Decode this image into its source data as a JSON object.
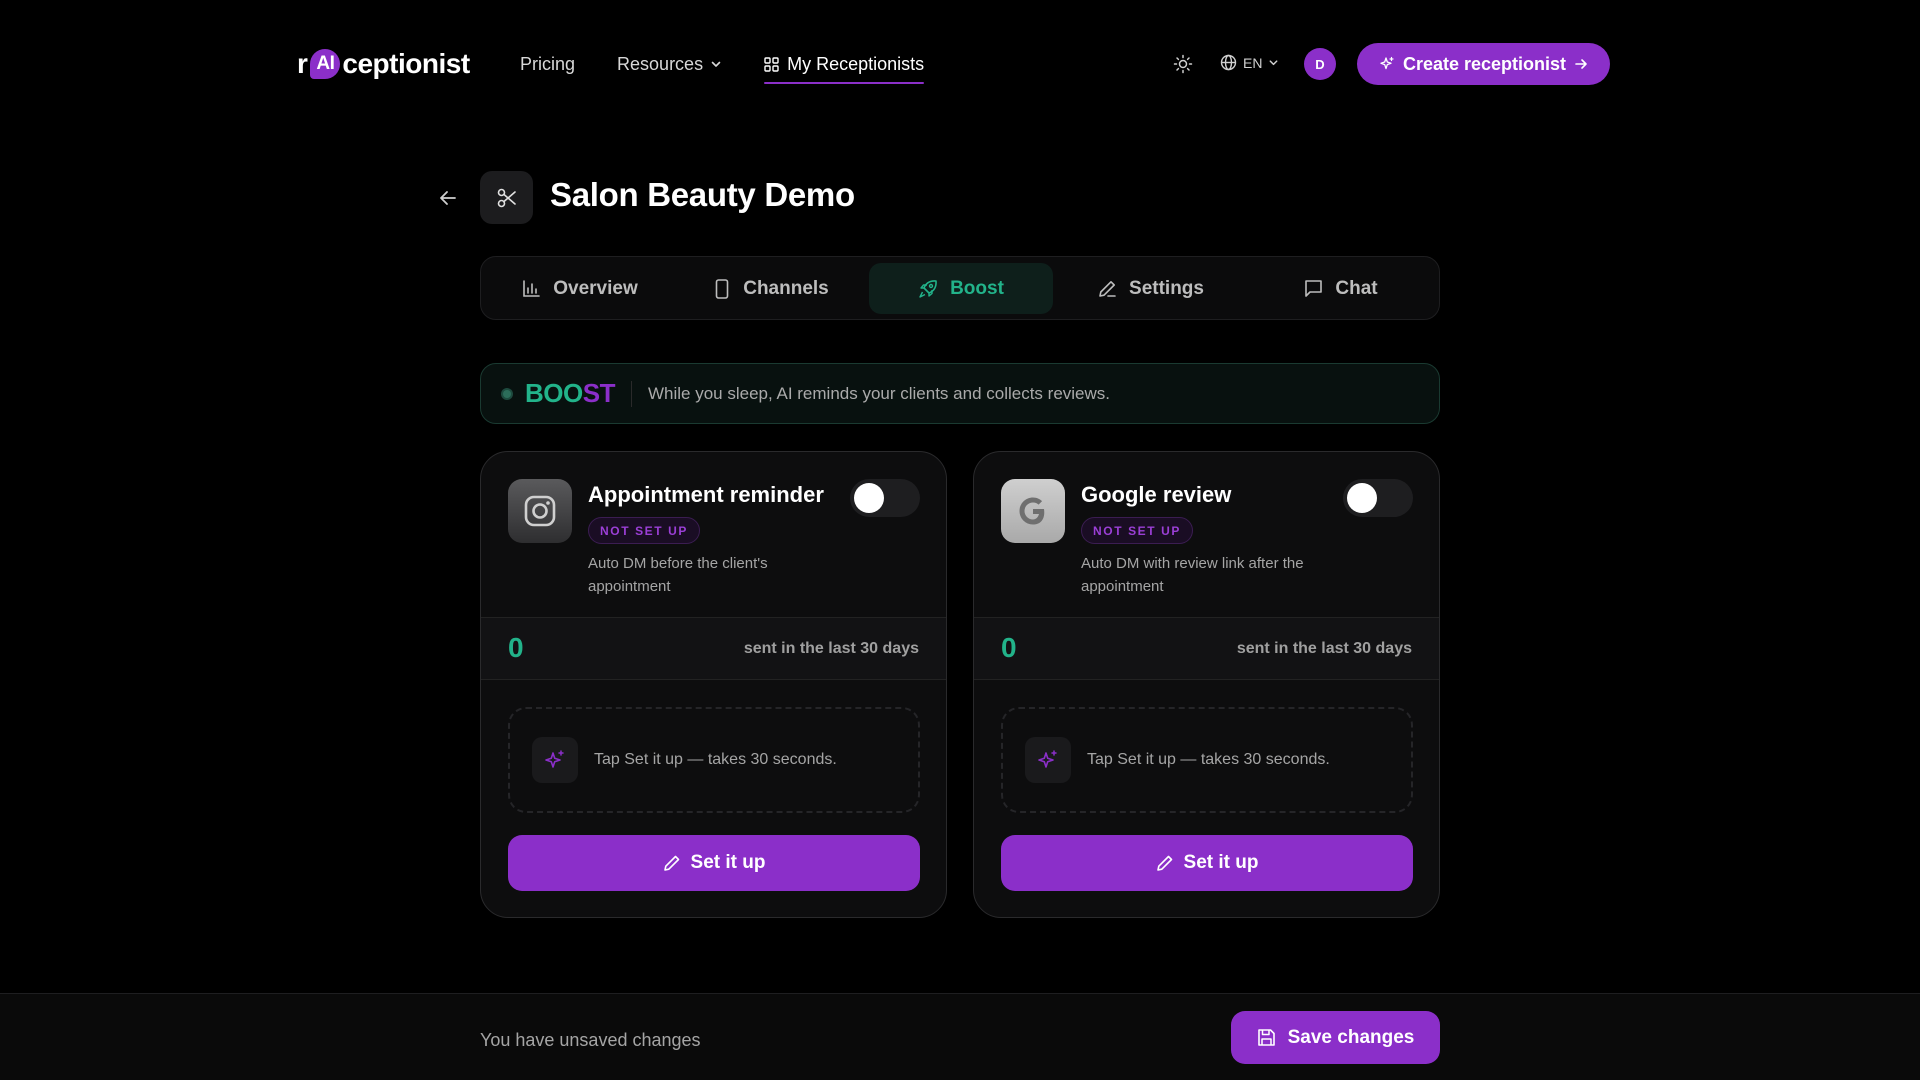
{
  "nav": {
    "logo_r": "r",
    "logo_ai": "AI",
    "logo_rest": "ceptionist",
    "links": [
      {
        "label": "Pricing"
      },
      {
        "label": "Resources"
      },
      {
        "label": "My Receptionists"
      }
    ],
    "lang": "EN",
    "avatar_initial": "D",
    "create_label": "Create receptionist"
  },
  "page": {
    "title": "Salon Beauty Demo"
  },
  "tabs": [
    {
      "label": "Overview",
      "icon": "bar-chart-icon"
    },
    {
      "label": "Channels",
      "icon": "phone-icon"
    },
    {
      "label": "Boost",
      "icon": "rocket-icon",
      "active": true
    },
    {
      "label": "Settings",
      "icon": "pencil-icon"
    },
    {
      "label": "Chat",
      "icon": "message-icon"
    }
  ],
  "banner": {
    "word_a": "BOO",
    "word_b": "ST",
    "text": "While you sleep, AI reminds your clients and collects reviews."
  },
  "cards": [
    {
      "title": "Appointment reminder",
      "icon": "instagram-icon",
      "badge": "NOT SET UP",
      "description": "Auto DM before the client's appointment",
      "enabled": false,
      "count": "0",
      "count_label": "sent in the last 30 days",
      "hint": "Tap Set it up — takes 30 seconds.",
      "button": "Set it up"
    },
    {
      "title": "Google review",
      "icon": "google-icon",
      "badge": "NOT SET UP",
      "description": "Auto DM with review link after the appointment",
      "enabled": false,
      "count": "0",
      "count_label": "sent in the last 30 days",
      "hint": "Tap Set it up — takes 30 seconds.",
      "button": "Set it up"
    }
  ],
  "footer": {
    "unsaved": "You have unsaved changes",
    "save_label": "Save changes"
  },
  "colors": {
    "accent": "#8b2fc9",
    "success": "#22b38a",
    "background": "#000000"
  }
}
